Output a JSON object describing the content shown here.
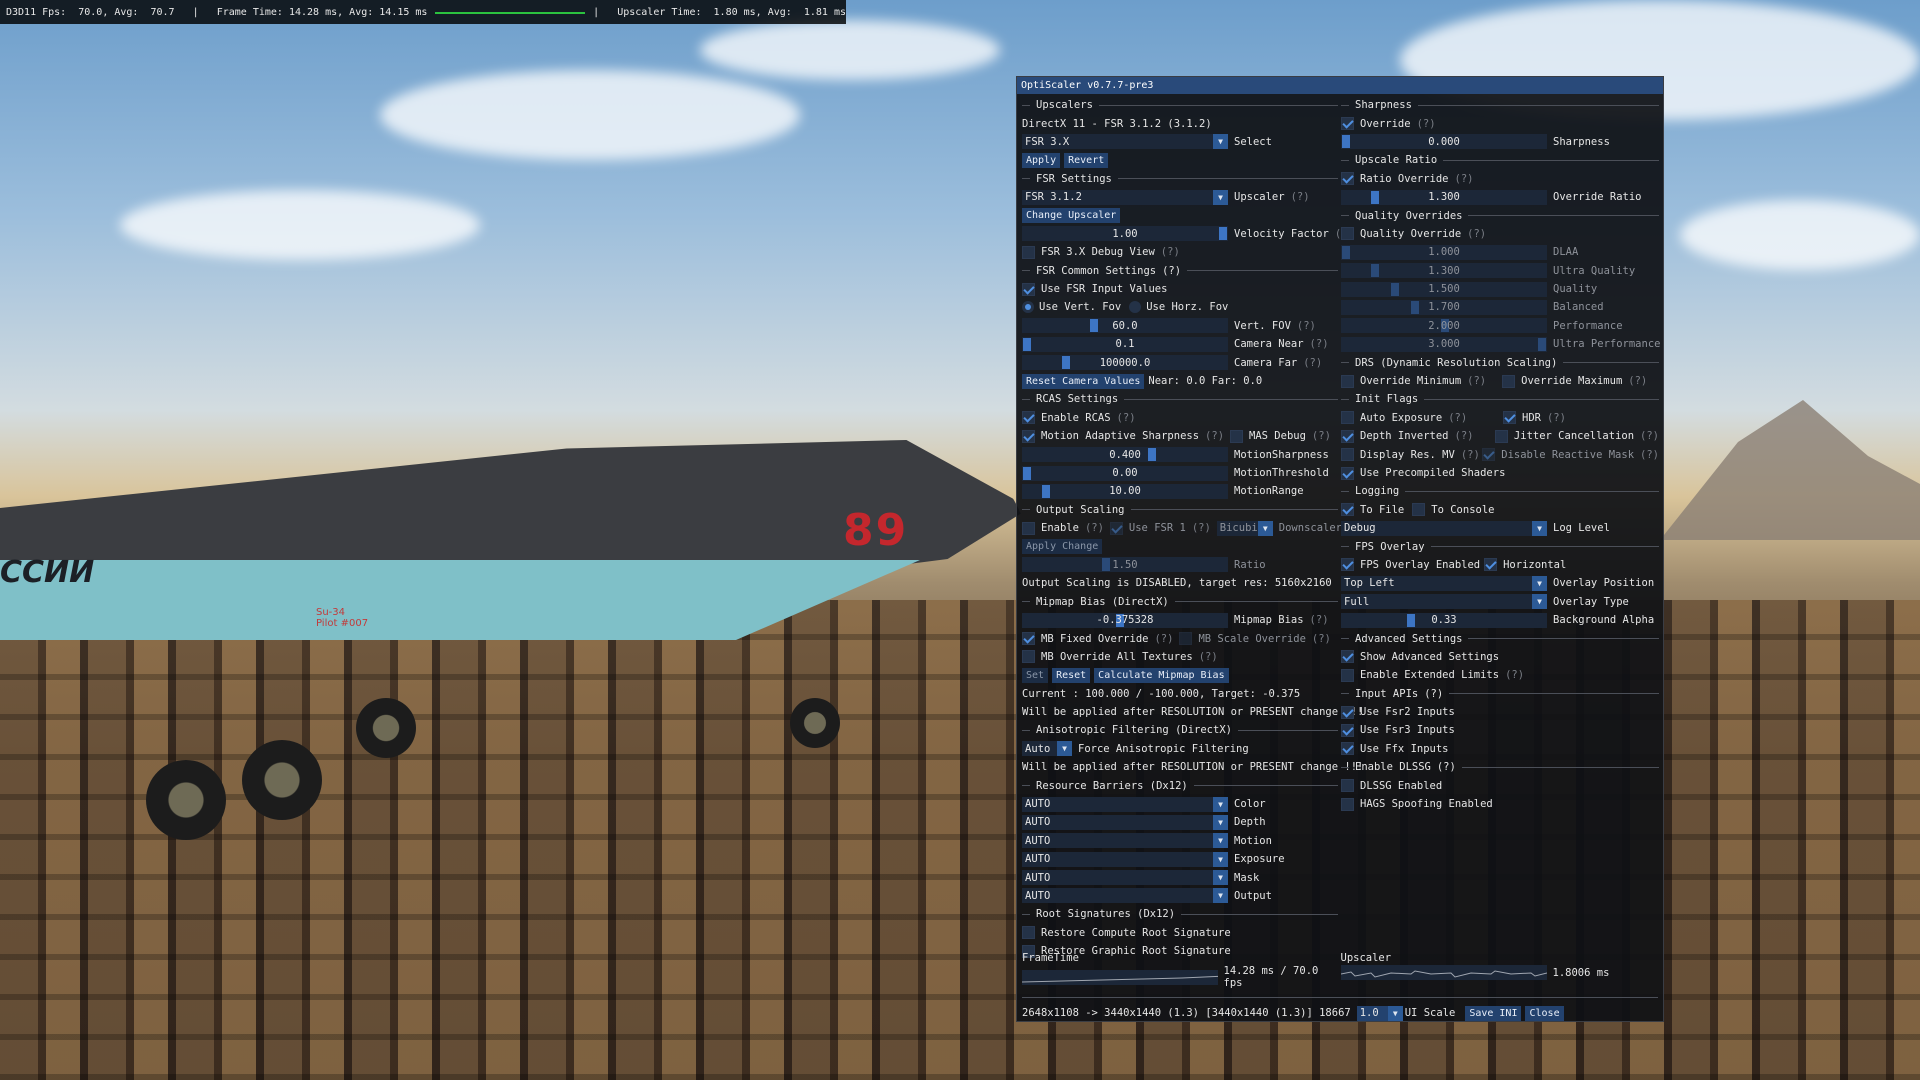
{
  "fps_overlay": {
    "fps_text": "D3D11 Fps:  70.0, Avg:  70.7   |   Frame Time: 14.28 ms, Avg: 14.15 ms",
    "upscaler_text": "|   Upscaler Time:  1.80 ms, Avg:  1.81 ms"
  },
  "scene": {
    "tail_number": "89",
    "fuselage_text": "ССИИ",
    "pilot_label": "Su-34\nPilot #007"
  },
  "panel": {
    "title": "OptiScaler v0.7.7-pre3",
    "upscalers": {
      "header": "Upscalers",
      "current": "DirectX 11 - FSR 3.1.2 (3.1.2)",
      "select_value": "FSR 3.X",
      "select_label": "Select",
      "apply": "Apply",
      "revert": "Revert"
    },
    "fsr_settings": {
      "header": "FSR Settings",
      "upscaler_value": "FSR 3.1.2",
      "upscaler_label": "Upscaler",
      "change_upscaler": "Change Upscaler",
      "velocity_value": "1.00",
      "velocity_label": "Velocity Factor",
      "debug_view": "FSR 3.X Debug View"
    },
    "fsr_common": {
      "header": "FSR Common Settings",
      "use_input_values": "Use FSR Input Values",
      "use_vert_fov": "Use Vert. Fov",
      "use_horz_fov": "Use Horz. Fov",
      "vert_fov_value": "60.0",
      "vert_fov_label": "Vert. FOV",
      "camera_near_value": "0.1",
      "camera_near_label": "Camera Near",
      "camera_far_value": "100000.0",
      "camera_far_label": "Camera Far",
      "reset_camera": "Reset Camera Values",
      "near_far_text": "Near: 0.0 Far: 0.0"
    },
    "rcas": {
      "header": "RCAS Settings",
      "enable": "Enable RCAS",
      "motion_adaptive": "Motion Adaptive Sharpness",
      "mas_debug": "MAS Debug",
      "motion_sharpness_value": "0.400",
      "motion_sharpness_label": "MotionSharpness",
      "motion_threshold_value": "0.00",
      "motion_threshold_label": "MotionThreshold",
      "motion_range_value": "10.00",
      "motion_range_label": "MotionRange"
    },
    "output_scaling": {
      "header": "Output Scaling",
      "enable": "Enable",
      "use_fsr1": "Use FSR 1",
      "downscaler_value": "Bicubic",
      "downscaler_label": "Downscaler",
      "apply_change": "Apply Change",
      "ratio_value": "1.50",
      "ratio_label": "Ratio",
      "status": "Output Scaling is DISABLED, target res: 5160x2160"
    },
    "mipmap": {
      "header": "Mipmap Bias (DirectX)",
      "bias_value": "-0.375328",
      "bias_label": "Mipmap Bias",
      "fixed_override": "MB Fixed Override",
      "scale_override": "MB Scale Override",
      "override_all": "MB Override All Textures",
      "set": "Set",
      "reset": "Reset",
      "calculate": "Calculate Mipmap Bias",
      "current": "Current : 100.000 / -100.000, Target: -0.375",
      "note": "Will be applied after RESOLUTION or PRESENT change !!!"
    },
    "anisotropic": {
      "header": "Anisotropic Filtering (DirectX)",
      "value": "Auto",
      "label": "Force Anisotropic Filtering",
      "note": "Will be applied after RESOLUTION or PRESENT change !!!"
    },
    "barriers": {
      "header": "Resource Barriers (Dx12)",
      "items": [
        {
          "value": "AUTO",
          "label": "Color"
        },
        {
          "value": "AUTO",
          "label": "Depth"
        },
        {
          "value": "AUTO",
          "label": "Motion"
        },
        {
          "value": "AUTO",
          "label": "Exposure"
        },
        {
          "value": "AUTO",
          "label": "Mask"
        },
        {
          "value": "AUTO",
          "label": "Output"
        }
      ]
    },
    "root_signatures": {
      "header": "Root Signatures (Dx12)",
      "compute": "Restore Compute Root Signature",
      "graphic": "Restore Graphic Root Signature"
    },
    "sharpness": {
      "header": "Sharpness",
      "override": "Override",
      "value": "0.000",
      "label": "Sharpness"
    },
    "upscale_ratio": {
      "header": "Upscale Ratio",
      "override": "Ratio Override",
      "value": "1.300",
      "label": "Override Ratio"
    },
    "quality": {
      "header": "Quality Overrides",
      "override": "Quality Override",
      "items": [
        {
          "value": "1.000",
          "label": "DLAA",
          "level": 0.0
        },
        {
          "value": "1.300",
          "label": "Ultra Quality",
          "level": 0.15
        },
        {
          "value": "1.500",
          "label": "Quality",
          "level": 0.25
        },
        {
          "value": "1.700",
          "label": "Balanced",
          "level": 0.35
        },
        {
          "value": "2.000",
          "label": "Performance",
          "level": 0.5
        },
        {
          "value": "3.000",
          "label": "Ultra Performance",
          "level": 1.0
        }
      ]
    },
    "drs": {
      "header": "DRS (Dynamic Resolution Scaling)",
      "override_min": "Override Minimum",
      "override_max": "Override Maximum"
    },
    "init_flags": {
      "header": "Init Flags",
      "auto_exposure": "Auto Exposure",
      "hdr": "HDR",
      "depth_inverted": "Depth Inverted",
      "jitter_cancellation": "Jitter Cancellation",
      "display_res_mv": "Display Res. MV",
      "disable_reactive": "Disable Reactive Mask",
      "precompiled": "Use Precompiled Shaders"
    },
    "logging": {
      "header": "Logging",
      "to_file": "To File",
      "to_console": "To Console",
      "level_value": "Debug",
      "level_label": "Log Level"
    },
    "fps_overlay_section": {
      "header": "FPS Overlay",
      "enabled": "FPS Overlay Enabled",
      "horizontal": "Horizontal",
      "position_value": "Top Left",
      "position_label": "Overlay Position",
      "type_value": "Full",
      "type_label": "Overlay Type",
      "alpha_value": "0.33",
      "alpha_label": "Background Alpha"
    },
    "advanced": {
      "header": "Advanced Settings",
      "show": "Show Advanced Settings",
      "extended": "Enable Extended Limits"
    },
    "input_apis": {
      "header": "Input APIs",
      "fsr2": "Use Fsr2 Inputs",
      "fsr3": "Use Fsr3 Inputs",
      "ffx": "Use Ffx Inputs"
    },
    "dlssg": {
      "header": "Enable DLSSG",
      "enabled": "DLSSG Enabled",
      "hags": "HAGS Spoofing Enabled"
    },
    "footer": {
      "frametime_label": "FrameTime",
      "frametime_text": "14.28 ms /  70.0 fps",
      "upscaler_label": "Upscaler",
      "upscaler_text": "1.8006 ms",
      "resolution_text": "2648x1108 -> 3440x1440 (1.3) [3440x1440 (1.3)] 18667",
      "ui_scale_value": "1.0",
      "ui_scale_label": "UI Scale",
      "save_ini": "Save INI",
      "close": "Close"
    },
    "help_mark": "(?)"
  },
  "colors": {
    "title_bar": "#294a7a",
    "accent": "#3d75c4",
    "frame_bg": "#1c2738",
    "fps_graph": "#2bc23f"
  }
}
